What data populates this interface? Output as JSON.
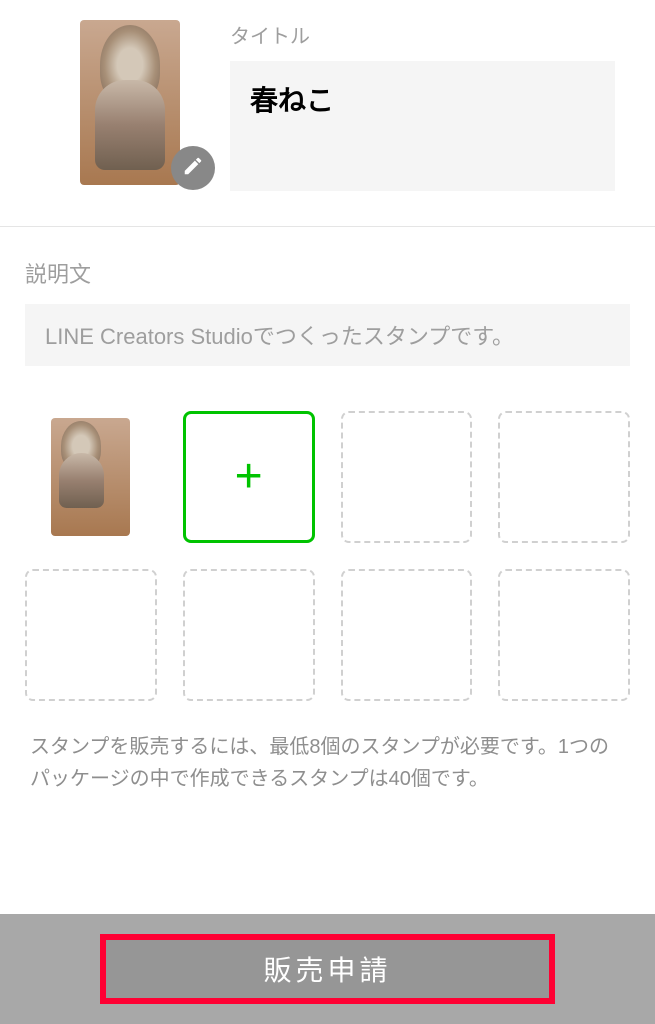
{
  "header": {
    "title_label": "タイトル",
    "title_value": "春ねこ"
  },
  "description": {
    "label": "説明文",
    "value": "LINE Creators Studioでつくったスタンプです。"
  },
  "stamps": {
    "add_icon": "+"
  },
  "help_text": "スタンプを販売するには、最低8個のスタンプが必要です。1つのパッケージの中で作成できるスタンプは40個です。",
  "footer": {
    "submit_label": "販売申請"
  }
}
